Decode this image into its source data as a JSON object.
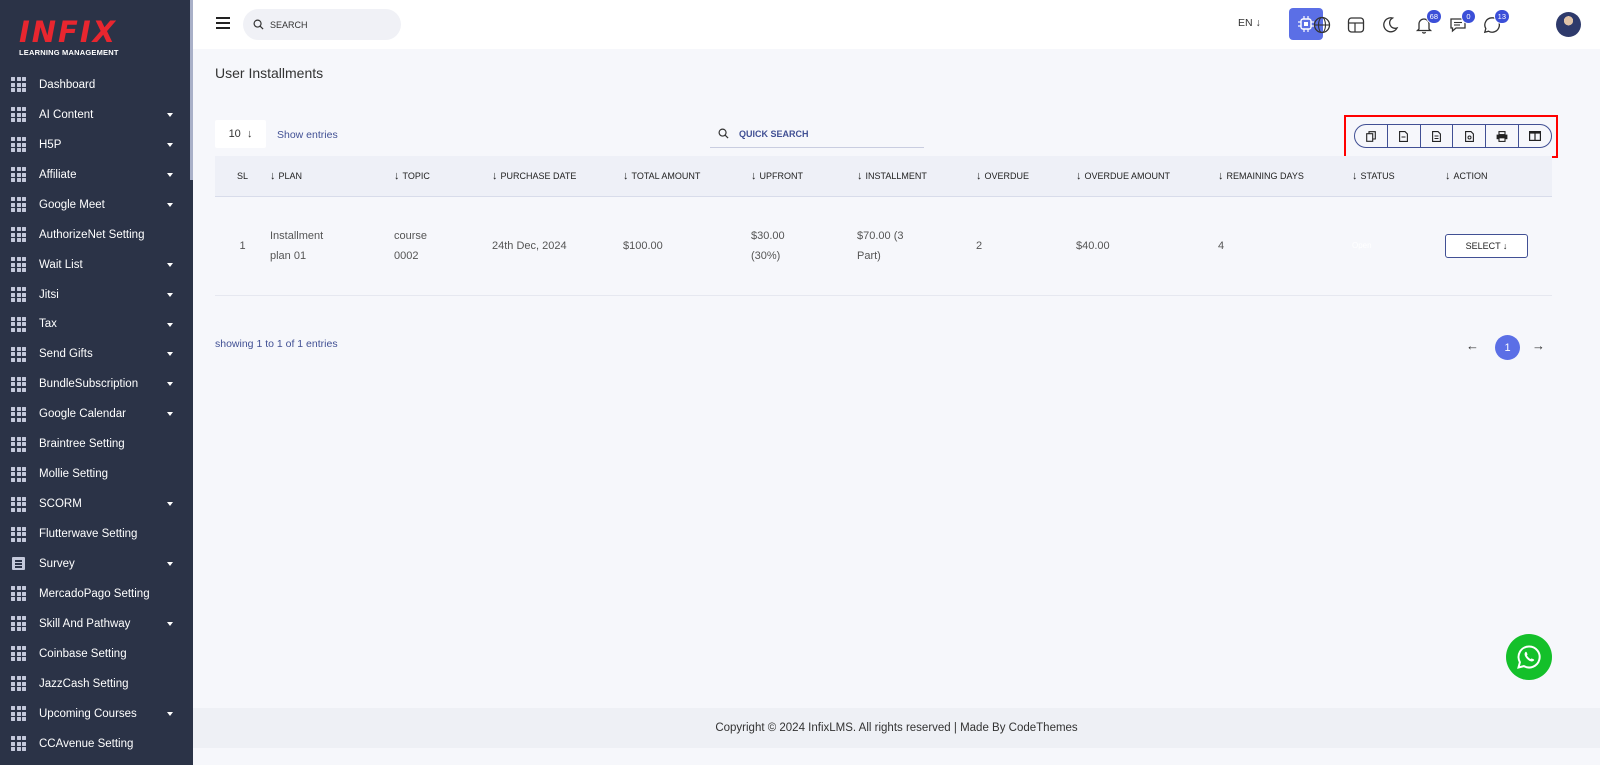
{
  "brand": {
    "logo_text": "INFIX",
    "logo_subtitle": "LEARNING MANAGEMENT",
    "logo_color": "#e8262f"
  },
  "sidebar": {
    "items": [
      {
        "label": "Dashboard",
        "icon": "grid-icon",
        "has_caret": false
      },
      {
        "label": "AI Content",
        "icon": "grid-icon",
        "has_caret": true
      },
      {
        "label": "H5P",
        "icon": "grid-icon",
        "has_caret": true
      },
      {
        "label": "Affiliate",
        "icon": "grid-icon",
        "has_caret": true
      },
      {
        "label": "Google Meet",
        "icon": "grid-icon",
        "has_caret": true
      },
      {
        "label": "AuthorizeNet Setting",
        "icon": "grid-icon",
        "has_caret": false
      },
      {
        "label": "Wait List",
        "icon": "grid-icon",
        "has_caret": true
      },
      {
        "label": "Jitsi",
        "icon": "grid-icon",
        "has_caret": true
      },
      {
        "label": "Tax",
        "icon": "grid-icon",
        "has_caret": true
      },
      {
        "label": "Send Gifts",
        "icon": "grid-icon",
        "has_caret": true
      },
      {
        "label": "BundleSubscription",
        "icon": "grid-icon",
        "has_caret": true
      },
      {
        "label": "Google Calendar",
        "icon": "grid-icon",
        "has_caret": true
      },
      {
        "label": "Braintree Setting",
        "icon": "grid-icon",
        "has_caret": false
      },
      {
        "label": "Mollie Setting",
        "icon": "grid-icon",
        "has_caret": false
      },
      {
        "label": "SCORM",
        "icon": "grid-icon",
        "has_caret": true
      },
      {
        "label": "Flutterwave Setting",
        "icon": "grid-icon",
        "has_caret": false
      },
      {
        "label": "Survey",
        "icon": "document-icon",
        "has_caret": true
      },
      {
        "label": "MercadoPago Setting",
        "icon": "grid-icon",
        "has_caret": false
      },
      {
        "label": "Skill And Pathway",
        "icon": "grid-icon",
        "has_caret": true
      },
      {
        "label": "Coinbase Setting",
        "icon": "grid-icon",
        "has_caret": false
      },
      {
        "label": "JazzCash Setting",
        "icon": "grid-icon",
        "has_caret": false
      },
      {
        "label": "Upcoming Courses",
        "icon": "grid-icon",
        "has_caret": true
      },
      {
        "label": "CCAvenue Setting",
        "icon": "grid-icon",
        "has_caret": false
      }
    ]
  },
  "topbar": {
    "search_placeholder": "SEARCH",
    "language": "EN",
    "language_arrow": "↓",
    "notifications_count": "68",
    "messages_count": "0",
    "chat_count": "13",
    "accent_color": "#5b6fe6"
  },
  "page": {
    "title": "User Installments",
    "entries_value": "10",
    "entries_arrow": "↓",
    "show_entries_label": "Show entries",
    "quick_search_placeholder": "QUICK SEARCH",
    "export_buttons": [
      "copy-icon",
      "csv-icon",
      "excel-icon",
      "pdf-icon",
      "print-icon",
      "columns-icon"
    ]
  },
  "table": {
    "columns": [
      "SL",
      "PLAN",
      "TOPIC",
      "PURCHASE DATE",
      "TOTAL AMOUNT",
      "UPFRONT",
      "INSTALLMENT",
      "OVERDUE",
      "OVERDUE AMOUNT",
      "REMAINING DAYS",
      "STATUS",
      "ACTION"
    ],
    "sort_arrow": "↓",
    "rows": [
      {
        "sl": "1",
        "plan": "Installment plan 01",
        "topic": "course 0002",
        "purchase_date": "24th Dec, 2024",
        "total_amount": "$100.00",
        "upfront": "$30.00 (30%)",
        "installment": "$70.00 (3 Part)",
        "overdue": "2",
        "overdue_amount": "$40.00",
        "remaining_days": "4",
        "status": "Open",
        "action_label": "SELECT ↓"
      }
    ]
  },
  "pagination": {
    "showing_text": "showing 1 to 1 of 1 entries",
    "prev": "←",
    "current_page": "1",
    "next": "→"
  },
  "footer": {
    "text": "Copyright © 2024 InfixLMS. All rights reserved | Made By CodeThemes"
  },
  "whatsapp_color": "#14c02a"
}
